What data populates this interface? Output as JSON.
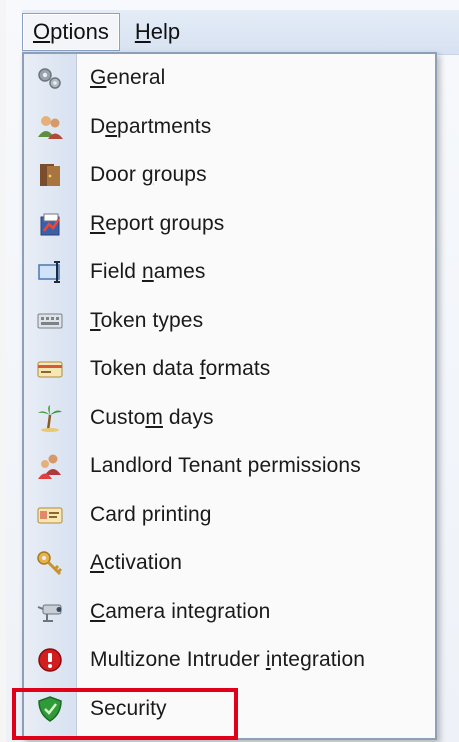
{
  "menubar": {
    "options": {
      "label_mnemonic": "O",
      "label_rest": "ptions"
    },
    "help": {
      "label_mnemonic": "H",
      "label_rest": "elp"
    }
  },
  "menu": {
    "items": [
      {
        "pre": "",
        "mn": "G",
        "post": "eneral",
        "icon": "gears-icon"
      },
      {
        "pre": "D",
        "mn": "e",
        "post": "partments",
        "icon": "people-icon"
      },
      {
        "pre": "Door ",
        "mn": "g",
        "post": "roups",
        "icon": "door-icon"
      },
      {
        "pre": "",
        "mn": "R",
        "post": "eport groups",
        "icon": "report-icon"
      },
      {
        "pre": "Field ",
        "mn": "n",
        "post": "ames",
        "icon": "text-field-icon"
      },
      {
        "pre": "",
        "mn": "T",
        "post": "oken types",
        "icon": "keypad-icon"
      },
      {
        "pre": "Token data ",
        "mn": "f",
        "post": "ormats",
        "icon": "card-icon"
      },
      {
        "pre": "Custo",
        "mn": "m",
        "post": " days",
        "icon": "palm-tree-icon"
      },
      {
        "pre": "Landlord Tenant permissions",
        "mn": "",
        "post": "",
        "icon": "landlord-icon"
      },
      {
        "pre": "Card printing",
        "mn": "",
        "post": "",
        "icon": "card-print-icon"
      },
      {
        "pre": "",
        "mn": "A",
        "post": "ctivation",
        "icon": "key-icon"
      },
      {
        "pre": "",
        "mn": "C",
        "post": "amera integration",
        "icon": "camera-icon"
      },
      {
        "pre": "Multizone Intruder ",
        "mn": "i",
        "post": "ntegration",
        "icon": "alarm-icon"
      },
      {
        "pre": "Security",
        "mn": "",
        "post": "",
        "icon": "shield-icon"
      }
    ]
  },
  "colors": {
    "highlight": "#e0001a",
    "menubar_bg": "#dbe5f3",
    "gutter_bg": "#e3eaf4"
  }
}
